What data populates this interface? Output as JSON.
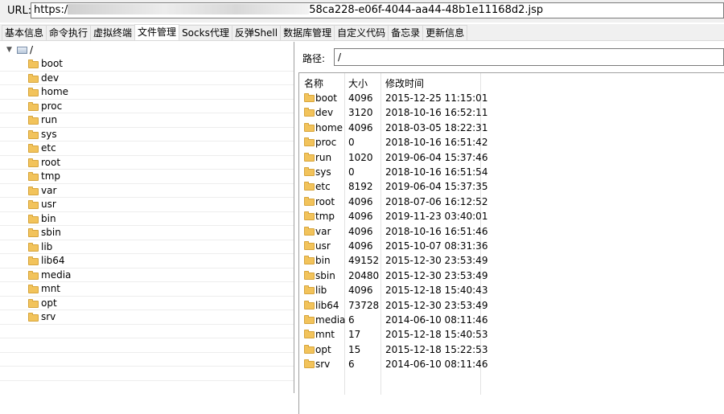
{
  "url_bar": {
    "label": "URL:",
    "prefix": "https:/",
    "suffix": "58ca228-e06f-4044-aa44-48b1e11168d2.jsp"
  },
  "tabs": [
    "基本信息",
    "命令执行",
    "虚拟终端",
    "文件管理",
    "Socks代理",
    "反弹Shell",
    "数据库管理",
    "自定义代码",
    "备忘录",
    "更新信息"
  ],
  "active_tab": "文件管理",
  "tree": {
    "root": "/",
    "items": [
      "boot",
      "dev",
      "home",
      "proc",
      "run",
      "sys",
      "etc",
      "root",
      "tmp",
      "var",
      "usr",
      "bin",
      "sbin",
      "lib",
      "lib64",
      "media",
      "mnt",
      "opt",
      "srv"
    ]
  },
  "path": {
    "label": "路径:",
    "value": "/"
  },
  "table": {
    "headers": [
      "名称",
      "大小",
      "修改时间"
    ],
    "rows": [
      [
        "boot",
        "4096",
        "2015-12-25 11:15:01"
      ],
      [
        "dev",
        "3120",
        "2018-10-16 16:52:11"
      ],
      [
        "home",
        "4096",
        "2018-03-05 18:22:31"
      ],
      [
        "proc",
        "0",
        "2018-10-16 16:51:42"
      ],
      [
        "run",
        "1020",
        "2019-06-04 15:37:46"
      ],
      [
        "sys",
        "0",
        "2018-10-16 16:51:54"
      ],
      [
        "etc",
        "8192",
        "2019-06-04 15:37:35"
      ],
      [
        "root",
        "4096",
        "2018-07-06 16:12:52"
      ],
      [
        "tmp",
        "4096",
        "2019-11-23 03:40:01"
      ],
      [
        "var",
        "4096",
        "2018-10-16 16:51:46"
      ],
      [
        "usr",
        "4096",
        "2015-10-07 08:31:36"
      ],
      [
        "bin",
        "49152",
        "2015-12-30 23:53:49"
      ],
      [
        "sbin",
        "20480",
        "2015-12-30 23:53:49"
      ],
      [
        "lib",
        "4096",
        "2015-12-18 15:40:43"
      ],
      [
        "lib64",
        "73728",
        "2015-12-30 23:53:49"
      ],
      [
        "media",
        "6",
        "2014-06-10 08:11:46"
      ],
      [
        "mnt",
        "17",
        "2015-12-18 15:40:53"
      ],
      [
        "opt",
        "15",
        "2015-12-18 15:22:53"
      ],
      [
        "srv",
        "6",
        "2014-06-10 08:11:46"
      ]
    ]
  }
}
